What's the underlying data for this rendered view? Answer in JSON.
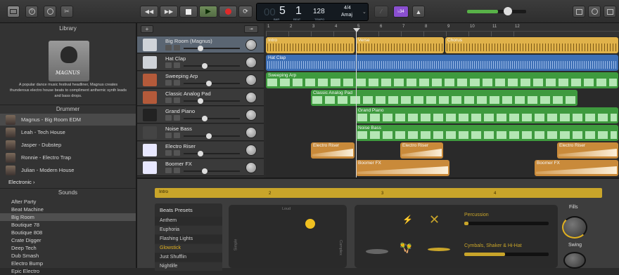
{
  "toolbar": {
    "lcd": {
      "bar_small": "00",
      "bar": "5",
      "beat": "1",
      "bar_label": "BAR",
      "beat_label": "BEAT",
      "tempo": "128",
      "tempo_label": "TEMPO",
      "sig": "4/4",
      "key": "Amaj"
    },
    "tuner_label": "♭34"
  },
  "library": {
    "title": "Library",
    "artist_name": "MAGNUS",
    "description": "A popular dance music festival headliner, Magnus creates thunderous electro house beats to compliment anthemic synth leads and bass drops.",
    "drummer_title": "Drummer",
    "drummers": [
      "Magnus - Big Room EDM",
      "Leah - Tech House",
      "Jasper - Dubstep",
      "Ronnie - Electro Trap",
      "Julian - Modern House"
    ],
    "genre": "Electronic",
    "sounds_title": "Sounds",
    "sounds": [
      "After Party",
      "Beat Machine",
      "Big Room",
      "Boutique 78",
      "Boutique 808",
      "Crate Digger",
      "Deep Tech",
      "Dub Smash",
      "Electro Bump",
      "Epic Electro"
    ]
  },
  "tracks": [
    {
      "name": "Big Room (Magnus)",
      "icon_color": "#cfd3d8",
      "selected": true
    },
    {
      "name": "Hat Clap",
      "icon_color": "#cfd3d8"
    },
    {
      "name": "Sweeping Arp",
      "icon_color": "#b45a3a"
    },
    {
      "name": "Classic Analog Pad",
      "icon_color": "#b45a3a"
    },
    {
      "name": "Grand Piano",
      "icon_color": "#222"
    },
    {
      "name": "Noise Bass",
      "icon_color": "#444"
    },
    {
      "name": "Electro Riser",
      "icon_color": "#e8e8ff"
    },
    {
      "name": "Boomer FX",
      "icon_color": "#e8e8ff"
    }
  ],
  "ruler": [
    "1",
    "2",
    "3",
    "4",
    "5",
    "6",
    "7",
    "8",
    "9",
    "10",
    "11",
    "12"
  ],
  "regions": [
    {
      "row": 0,
      "start": 0,
      "end": 127,
      "label": "Intro",
      "color": "#e0b24a",
      "kind": "drum"
    },
    {
      "row": 0,
      "start": 128,
      "end": 254,
      "label": "Verse",
      "color": "#e0b24a",
      "kind": "drum"
    },
    {
      "row": 0,
      "start": 255,
      "end": 502,
      "label": "Chorus",
      "color": "#e0b24a",
      "kind": "drum"
    },
    {
      "row": 1,
      "start": 0,
      "end": 502,
      "label": "Hat Clap",
      "color": "#3d6fb5",
      "kind": "wave"
    },
    {
      "row": 2,
      "start": 0,
      "end": 502,
      "label": "Sweeping Arp",
      "color": "#3e9a3e",
      "kind": "midi"
    },
    {
      "row": 3,
      "start": 64,
      "end": 444,
      "label": "Classic Analog Pad",
      "color": "#3e9a3e",
      "kind": "midi"
    },
    {
      "row": 4,
      "start": 128,
      "end": 502,
      "label": "Grand Piano",
      "color": "#3e9a3e",
      "kind": "midi"
    },
    {
      "row": 5,
      "start": 128,
      "end": 502,
      "label": "Noise Bass",
      "color": "#3e9a3e",
      "kind": "midi"
    },
    {
      "row": 6,
      "start": 64,
      "end": 127,
      "label": "Electro Riser",
      "color": "#c98a3a",
      "kind": "riser"
    },
    {
      "row": 6,
      "start": 191,
      "end": 253,
      "label": "Electro Riser",
      "color": "#c98a3a",
      "kind": "riser"
    },
    {
      "row": 6,
      "start": 414,
      "end": 502,
      "label": "Electro Riser",
      "color": "#c98a3a",
      "kind": "riser"
    },
    {
      "row": 7,
      "start": 128,
      "end": 262,
      "label": "Boomer FX",
      "color": "#c98a3a",
      "kind": "riser"
    },
    {
      "row": 7,
      "start": 382,
      "end": 502,
      "label": "Boomer FX",
      "color": "#c98a3a",
      "kind": "riser"
    }
  ],
  "editor": {
    "region_label": "Intro",
    "ruler": [
      "2",
      "3",
      "4"
    ],
    "presets_title": "Beats Presets",
    "presets": [
      "Anthem",
      "Euphoria",
      "Flashing Lights",
      "Glowstick",
      "Just Shufflin",
      "Nightlife"
    ],
    "selected_preset": "Glowstick",
    "loud": "Loud",
    "simple": "Simple",
    "complex": "Complex",
    "percussion": "Percussion",
    "cymbals": "Cymbals, Shaker & Hi-Hat",
    "fills": "Fills",
    "swing": "Swing"
  }
}
